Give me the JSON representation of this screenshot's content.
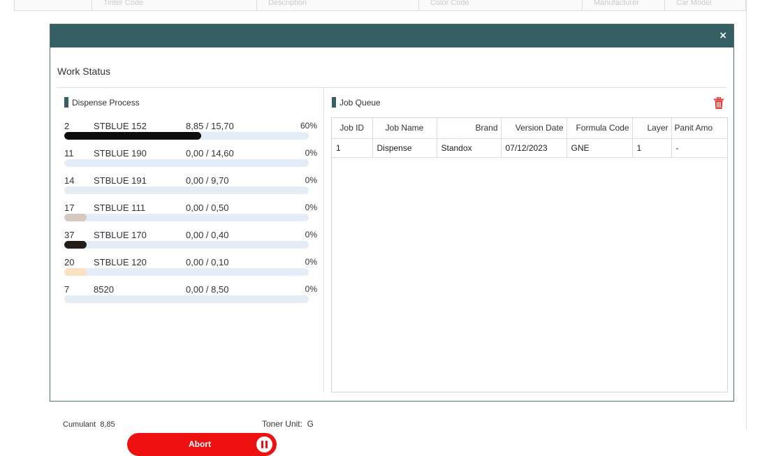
{
  "background": {
    "table_columns": [
      "Tinter Code",
      "Description",
      "Color Code",
      "Manufacturer",
      "Car Model"
    ]
  },
  "modal": {
    "title": "Work Status",
    "close_symbol": "×",
    "header_color": "#355f63"
  },
  "dispense": {
    "heading": "Dispense Process",
    "rows": [
      {
        "num": "2",
        "name": "STBLUE 152",
        "amount": "8,85 / 15,70",
        "pct": "60%",
        "progress": 0.56,
        "color": "#0d0d0d"
      },
      {
        "num": "11",
        "name": "STBLUE 190",
        "amount": "0,00 / 14,60",
        "pct": "0%",
        "progress": 0.09,
        "color": "#e4ecf5"
      },
      {
        "num": "14",
        "name": "STBLUE 191",
        "amount": "0,00 / 9,70",
        "pct": "0%",
        "progress": 0.09,
        "color": "#e4ecf5"
      },
      {
        "num": "17",
        "name": "STBLUE 111",
        "amount": "0,00 / 0,50",
        "pct": "0%",
        "progress": 0.09,
        "color": "#d8c9c0"
      },
      {
        "num": "37",
        "name": "STBLUE 170",
        "amount": "0,00 / 0,40",
        "pct": "0%",
        "progress": 0.09,
        "color": "#231c1a"
      },
      {
        "num": "20",
        "name": "STBLUE 120",
        "amount": "0,00 / 0,10",
        "pct": "0%",
        "progress": 0.09,
        "color": "#fbe1c4"
      },
      {
        "num": "7",
        "name": "8520",
        "amount": "0,00 / 8,50",
        "pct": "0%",
        "progress": 0.09,
        "color": "#e4ecf5"
      }
    ],
    "cumulant_label": "Cumulant",
    "cumulant_value": "8,85",
    "toner_unit_label": "Toner Unit:",
    "toner_unit_value": "G",
    "abort_label": "Abort"
  },
  "job_queue": {
    "heading": "Job Queue",
    "columns": [
      "Job ID",
      "Job Name",
      "Brand",
      "Version Date",
      "Formula Code",
      "Layer",
      "Panit Amo"
    ],
    "rows": [
      [
        "1",
        "Dispense",
        "Standox",
        "07/12/2023",
        "GNE",
        "1",
        "-"
      ]
    ]
  },
  "icons": {
    "close": "close-icon",
    "delete": "trash-icon",
    "pause": "pause-icon"
  },
  "colors": {
    "accent": "#355f63",
    "danger": "#ee1111",
    "track": "#e4ecf5"
  }
}
